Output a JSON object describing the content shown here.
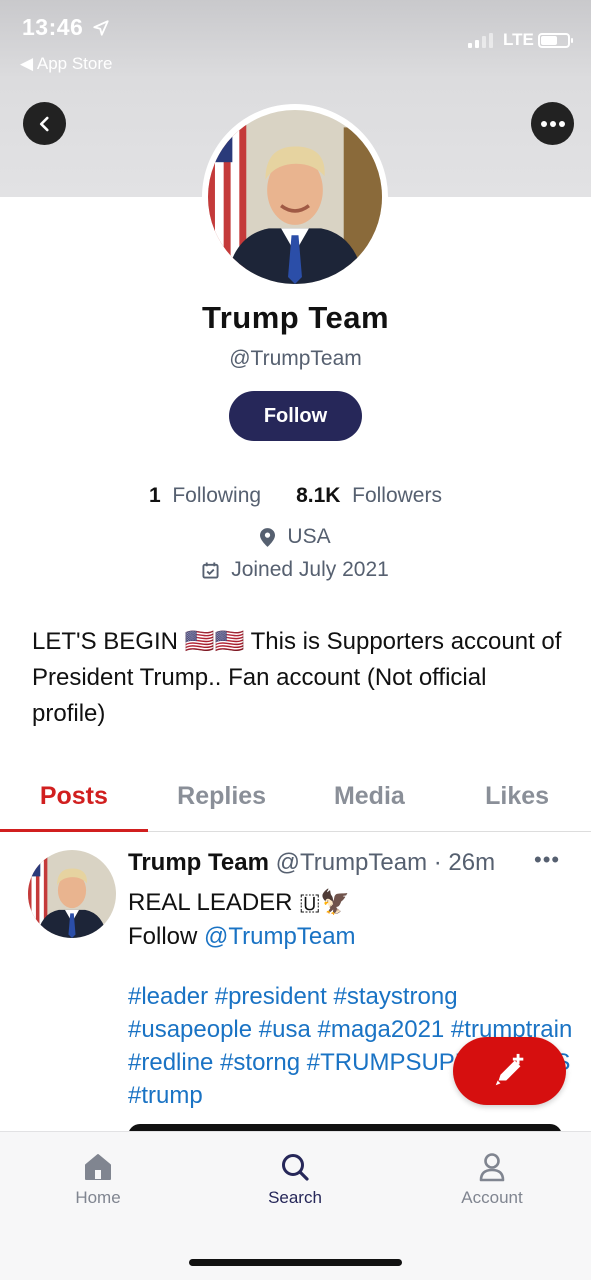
{
  "status_bar": {
    "time": "13:46",
    "back_app": "◀ App Store",
    "network": "LTE",
    "battery_level": 0.6
  },
  "profile": {
    "name": "Trump Team",
    "handle": "@TrumpTeam",
    "follow_label": "Follow",
    "following_count": "1",
    "following_label": "Following",
    "followers_count": "8.1K",
    "followers_label": "Followers",
    "location": "USA",
    "joined": "Joined July 2021",
    "bio": "LET'S BEGIN 🇺🇸🇺🇸  This is Supporters account of President Trump.. Fan account (Not official profile)"
  },
  "tabs": [
    {
      "label": "Posts",
      "active": true
    },
    {
      "label": "Replies",
      "active": false
    },
    {
      "label": "Media",
      "active": false
    },
    {
      "label": "Likes",
      "active": false
    }
  ],
  "post": {
    "author": "Trump Team",
    "handle": "@TrumpTeam",
    "time": "· 26m",
    "more": "•••",
    "line1": "REAL LEADER 🇺🦅",
    "follow_prefix": "Follow ",
    "follow_mention": "@TrumpTeam",
    "hashtags": "#leader #president #staystrong #usapeople #usa #maga2021 #trumptrain #redline #storng #TRUMPSUPPORTERS #trump"
  },
  "bottom_nav": {
    "home": "Home",
    "search": "Search",
    "account": "Account"
  },
  "colors": {
    "accent_red": "#d60f0f",
    "follow_navy": "#262759",
    "link_blue": "#1a73c4"
  },
  "icons": [
    "back-arrow-icon",
    "more-dots-icon",
    "location-pin-icon",
    "calendar-icon",
    "compose-icon",
    "home-icon",
    "search-icon",
    "account-icon"
  ]
}
